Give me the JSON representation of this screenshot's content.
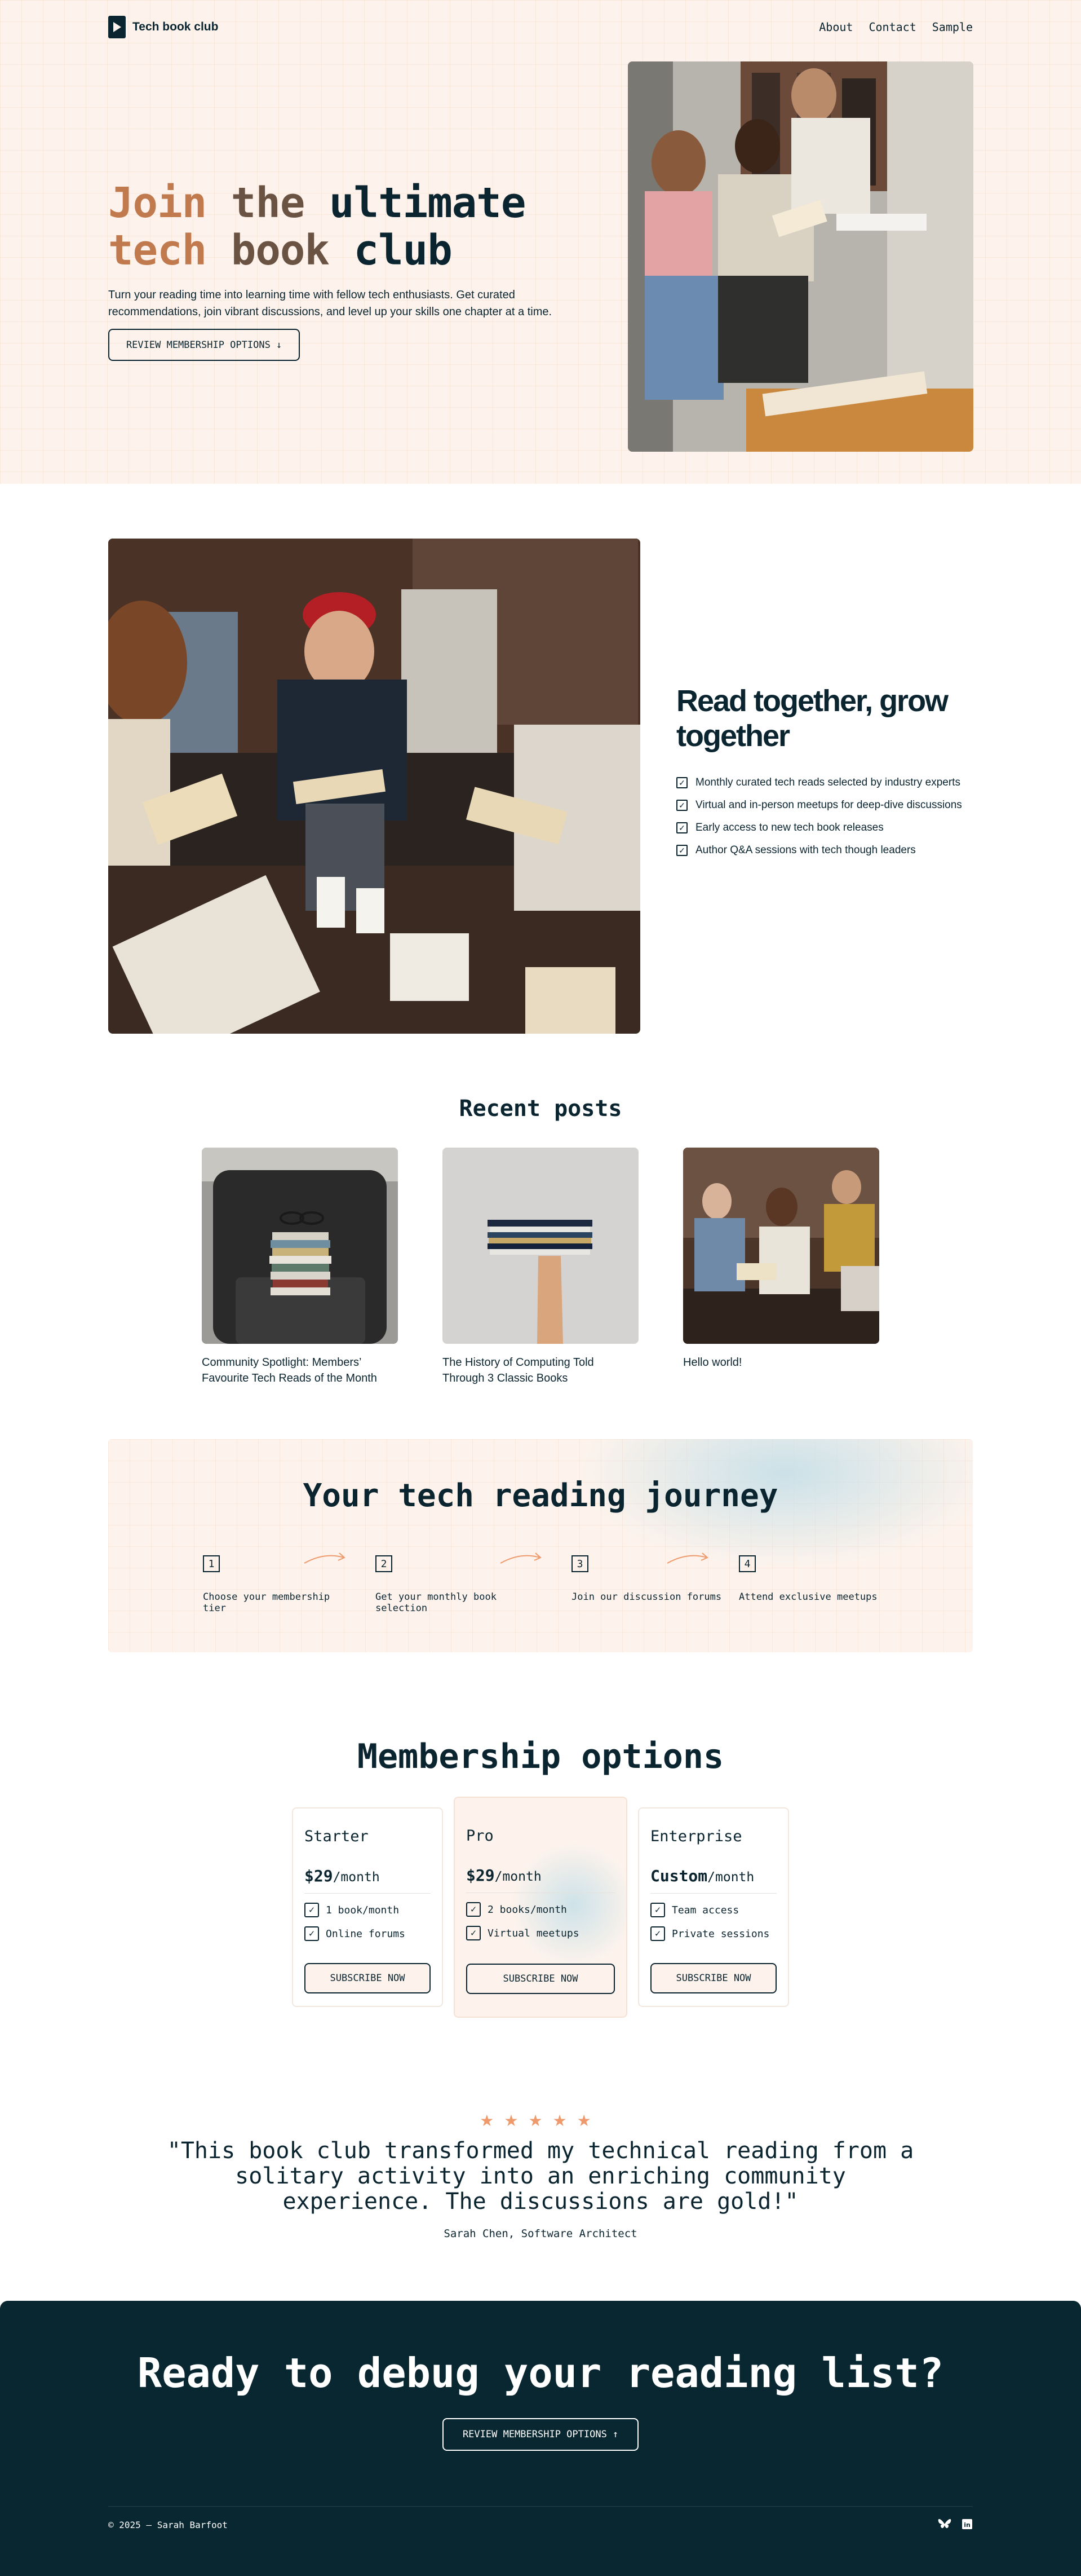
{
  "nav": {
    "brand": "Tech book club",
    "links": [
      "About",
      "Contact",
      "Sample"
    ]
  },
  "hero": {
    "title_1": "Join",
    "title_2": "the",
    "title_3": "ultimate",
    "title_4": "tech",
    "title_5": "book",
    "title_6": "club",
    "text": "Turn your reading time into learning time with fellow tech enthusiasts. Get curated recommendations, join vibrant discussions, and level up your skills one chapter at a time.",
    "button": "REVIEW MEMBERSHIP OPTIONS",
    "button_icon": "↓"
  },
  "features": {
    "title": "Read together, grow together",
    "items": [
      "Monthly curated tech reads selected by industry experts",
      "Virtual and in-person meetups for deep-dive discussions",
      "Early access to new tech book releases",
      "Author Q&A sessions with tech though leaders"
    ]
  },
  "posts": {
    "title": "Recent posts",
    "items": [
      "Community Spotlight: Members’ Favourite Tech Reads of the Month",
      "The History of Computing Told Through 3 Classic Books",
      "Hello world!"
    ]
  },
  "journey": {
    "title": "Your tech reading journey",
    "steps": [
      {
        "num": "1",
        "text": "Choose your membership tier"
      },
      {
        "num": "2",
        "text": "Get your monthly book selection"
      },
      {
        "num": "3",
        "text": "Join our discussion forums"
      },
      {
        "num": "4",
        "text": "Attend exclusive meetups"
      }
    ]
  },
  "membership": {
    "title": "Membership options",
    "per": "/month",
    "check": "✓",
    "plans": [
      {
        "name": "Starter",
        "price": "$29",
        "features": [
          "1 book/month",
          "Online forums"
        ],
        "button": "SUBSCRIBE NOW"
      },
      {
        "name": "Pro",
        "price": "$29",
        "features": [
          "2 books/month",
          "Virtual meetups"
        ],
        "button": "SUBSCRIBE NOW"
      },
      {
        "name": "Enterprise",
        "price": "Custom",
        "features": [
          "Team access",
          "Private sessions"
        ],
        "button": "SUBSCRIBE NOW"
      }
    ]
  },
  "testimonial": {
    "stars": "★★★★★",
    "rating": 5,
    "quote": "\"This book club transformed my technical reading from a solitary activity into an enriching community experience. The discussions are gold!\"",
    "author": "Sarah Chen, Software Architect"
  },
  "cta": {
    "title": "Ready to debug your reading list?",
    "button": "REVIEW MEMBERSHIP OPTIONS",
    "button_icon": "↑"
  },
  "footer": {
    "copyright": "© 2025 — Sarah Barfoot",
    "social": [
      "bluesky-icon",
      "linkedin-icon"
    ],
    "linkedin_text": "in"
  },
  "colors": {
    "accent": "#c07a4e",
    "dark": "#0b2530",
    "cream": "#fdf3ec",
    "star": "#ee9a6c"
  }
}
